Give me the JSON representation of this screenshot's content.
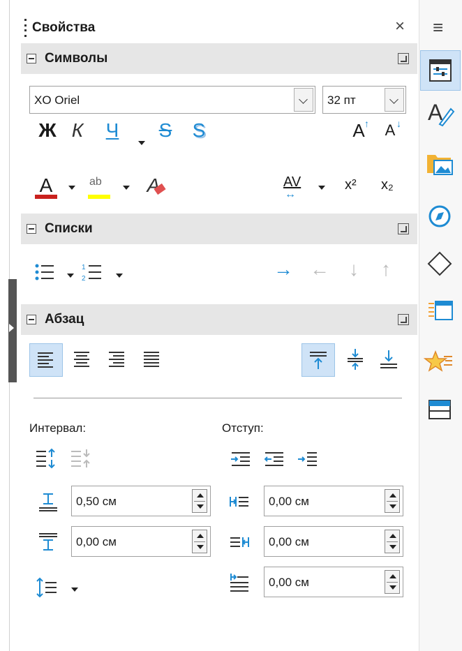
{
  "panel": {
    "title": "Свойства",
    "close_glyph": "×",
    "menu_glyph": "≡"
  },
  "characters": {
    "header": "Символы",
    "font_name": "XO Oriel",
    "font_size": "32 пт",
    "bold": "Ж",
    "italic": "К",
    "underline": "Ч",
    "strike": "S",
    "shadow": "S",
    "grow": "A",
    "shrink": "A",
    "font_color": "A",
    "highlight": "ab",
    "clear": "A",
    "spacing": "AV",
    "superscript": "x²",
    "subscript": "x₂"
  },
  "lists": {
    "header": "Списки",
    "arrows": [
      "→",
      "←",
      "↓",
      "↑"
    ]
  },
  "paragraph": {
    "header": "Абзац",
    "spacing_label": "Интервал:",
    "indent_label": "Отступ:",
    "above_value": "0,50 см",
    "below_value": "0,00 см",
    "before_indent_value": "0,00 см",
    "after_indent_value": "0,00 см",
    "first_line_value": "0,00 см"
  },
  "colors": {
    "accent_blue": "#1e8bd3",
    "font_color_bar": "#c9211e",
    "highlight_bar": "#ffff00",
    "section_bg": "#e6e6e6",
    "pressed_bg": "#cfe3f7"
  },
  "sidebar_tabs": [
    {
      "icon": "properties-icon"
    },
    {
      "icon": "styles-icon"
    },
    {
      "icon": "gallery-icon"
    },
    {
      "icon": "navigator-icon"
    },
    {
      "icon": "shapes-icon"
    },
    {
      "icon": "master-slides-icon"
    },
    {
      "icon": "animation-icon"
    },
    {
      "icon": "slide-transition-icon"
    }
  ]
}
